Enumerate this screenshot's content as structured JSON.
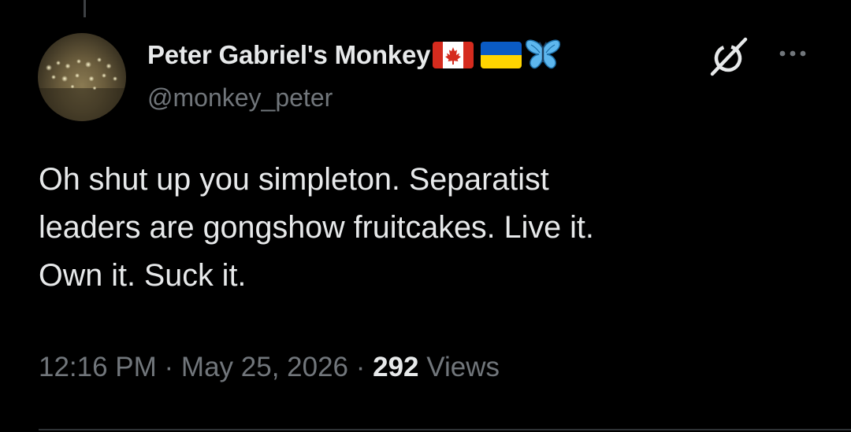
{
  "author": {
    "display_name": "Peter Gabriel's Monkey",
    "handle": "@monkey_peter",
    "flags": [
      "canada-flag",
      "ukraine-flag"
    ],
    "emoji": "butterfly-icon"
  },
  "tweet": {
    "text": "Oh shut up you simpleton. Separatist\nleaders are gongshow fruitcakes. Live it.\nOwn it. Suck it."
  },
  "meta": {
    "time": "12:16 PM",
    "separator": " · ",
    "date": "May 25, 2026",
    "views_count": "292",
    "views_label": "Views"
  },
  "colors": {
    "background": "#000000",
    "text_primary": "#e7e9ea",
    "text_secondary": "#71767b",
    "divider": "#2f3336"
  },
  "icons": {
    "grok": "grok-icon",
    "more": "more-icon"
  }
}
